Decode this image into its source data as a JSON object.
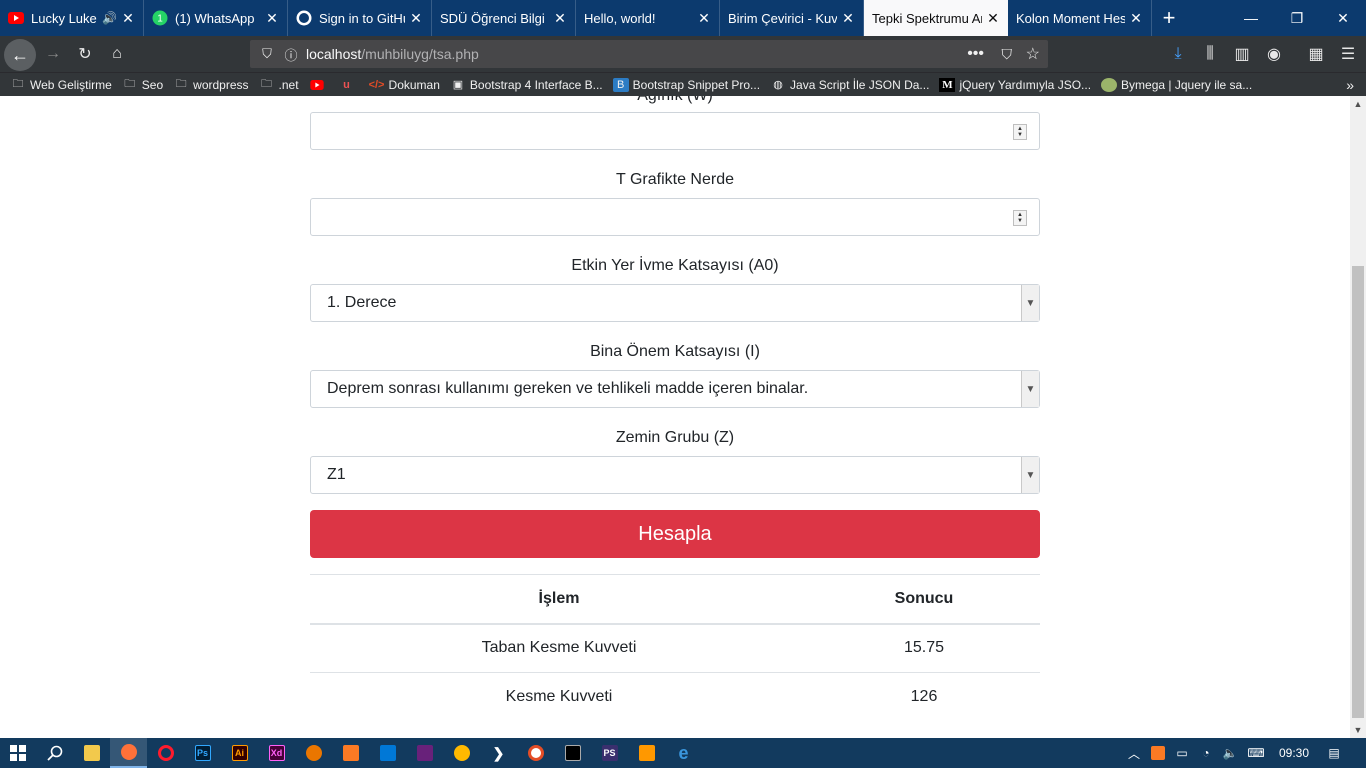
{
  "browser": {
    "tabs": [
      {
        "label": "Lucky Luke -",
        "icon": "youtube-icon",
        "audio": true,
        "active": false
      },
      {
        "label": "(1) WhatsApp",
        "icon": "whatsapp-icon",
        "audio": false,
        "active": false
      },
      {
        "label": "Sign in to GitHu",
        "icon": "github-icon",
        "audio": false,
        "active": false
      },
      {
        "label": "SDÜ Öğrenci Bilgi S",
        "icon": "none",
        "audio": false,
        "active": false
      },
      {
        "label": "Hello, world!",
        "icon": "none",
        "audio": false,
        "active": false
      },
      {
        "label": "Birim Çevirici - Kuv",
        "icon": "none",
        "audio": false,
        "active": false
      },
      {
        "label": "Tepki Spektrumu An",
        "icon": "none",
        "audio": false,
        "active": true
      },
      {
        "label": "Kolon Moment Hes",
        "icon": "none",
        "audio": false,
        "active": false
      }
    ],
    "url": {
      "host": "localhost",
      "path": "/muhbiluyg/tsa.php"
    },
    "bookmarks": [
      {
        "label": "Web Geliştirme",
        "icon": "folder-icon"
      },
      {
        "label": "Seo",
        "icon": "folder-icon"
      },
      {
        "label": "wordpress",
        "icon": "folder-icon"
      },
      {
        "label": ".net",
        "icon": "folder-icon"
      },
      {
        "label": "",
        "icon": "youtube-icon"
      },
      {
        "label": "",
        "icon": "udemy-icon"
      },
      {
        "label": "Dokuman",
        "icon": "code-icon"
      },
      {
        "label": "Bootstrap 4 Interface B...",
        "icon": "box-icon"
      },
      {
        "label": "Bootstrap Snippet Pro...",
        "icon": "bootstrap-icon"
      },
      {
        "label": "Java Script İle JSON Da...",
        "icon": "globe-icon"
      },
      {
        "label": "jQuery Yardımıyla JSO...",
        "icon": "medium-icon"
      },
      {
        "label": "Bymega | Jquery ile sa...",
        "icon": "avatar-icon"
      }
    ]
  },
  "form": {
    "partial_label": "Ağırlık (W)",
    "t_label": "T Grafikte Nerde",
    "a0_label": "Etkin Yer İvme Katsayısı (A0)",
    "a0_value": "1. Derece",
    "i_label": "Bina Önem Katsayısı (I)",
    "i_value": "Deprem sonrası kullanımı gereken ve tehlikeli madde içeren binalar.",
    "z_label": "Zemin Grubu (Z)",
    "z_value": "Z1",
    "submit_label": "Hesapla"
  },
  "results": {
    "headers": [
      "İşlem",
      "Sonucu"
    ],
    "rows": [
      [
        "Taban Kesme Kuvveti",
        "15.75"
      ],
      [
        "Kesme Kuvveti",
        "126"
      ]
    ]
  },
  "taskbar": {
    "clock": "09:30",
    "apps": [
      "file-explorer-icon",
      "firefox-icon",
      "opera-icon",
      "photoshop-icon",
      "illustrator-icon",
      "adobe-xd-icon",
      "blender-icon",
      "xampp-icon",
      "vscode-icon",
      "visual-studio-icon",
      "settings-gear-icon",
      "powershell-icon",
      "browser-icon",
      "cmd-icon",
      "powershell-ise-icon",
      "sublime-icon",
      "edge-icon"
    ],
    "app_labels": {
      "photoshop": "Ps",
      "illustrator": "Ai",
      "xd": "Xd",
      "ps_ise": "PS"
    }
  },
  "colors": {
    "accent_red": "#dc3545",
    "tabbar": "#0c3a6e",
    "navbar": "#323639",
    "taskbar": "#123a5e"
  }
}
